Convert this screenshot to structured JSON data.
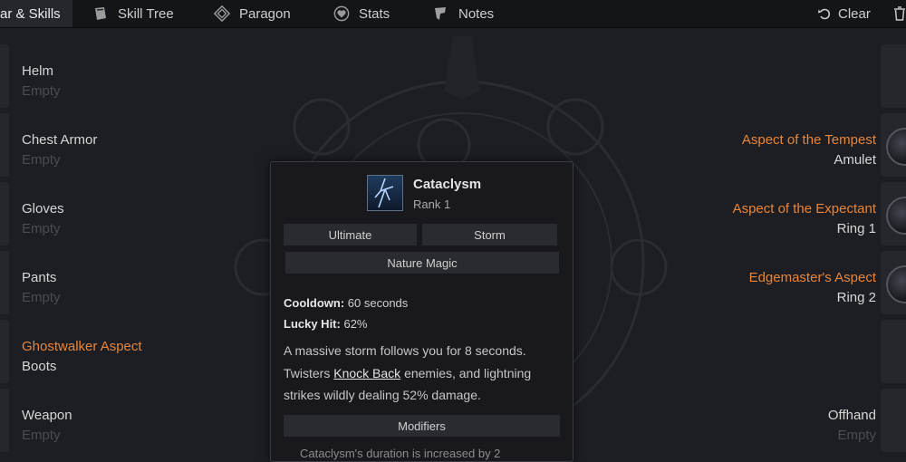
{
  "tabs": [
    {
      "label": "ar & Skills",
      "icon": "gear-skills-icon",
      "active": true
    },
    {
      "label": "Skill Tree",
      "icon": "book-icon"
    },
    {
      "label": "Paragon",
      "icon": "paragon-diamond-icon"
    },
    {
      "label": "Stats",
      "icon": "shield-heart-icon"
    },
    {
      "label": "Notes",
      "icon": "note-icon"
    }
  ],
  "toolbar": {
    "clear_label": "Clear",
    "clear_icon": "undo-icon",
    "delete_icon": "trash-icon"
  },
  "left_slots": [
    {
      "title": "Helm",
      "sub": "Empty"
    },
    {
      "title": "Chest Armor",
      "sub": "Empty"
    },
    {
      "title": "Gloves",
      "sub": "Empty"
    },
    {
      "title": "Pants",
      "sub": "Empty"
    },
    {
      "title": "Ghostwalker Aspect",
      "sub": "Boots"
    },
    {
      "title": "Weapon",
      "sub": "Empty"
    }
  ],
  "right_slots": [
    {
      "title": "Aspect of the Tempest",
      "sub": "Amulet"
    },
    {
      "title": "Aspect of the Expectant",
      "sub": "Ring 1"
    },
    {
      "title": "Edgemaster's Aspect",
      "sub": "Ring 2"
    },
    {
      "title": "Offhand",
      "sub": "Empty"
    }
  ],
  "tooltip": {
    "name": "Cataclysm",
    "rank": "Rank 1",
    "icon": "lightning-storm-icon",
    "tags": [
      "Ultimate",
      "Storm"
    ],
    "category": "Nature Magic",
    "cooldown_label": "Cooldown:",
    "cooldown_value": "60 seconds",
    "lucky_label": "Lucky Hit:",
    "lucky_value": "62%",
    "desc_1": "A massive storm follows you for 8 seconds. Twisters",
    "desc_link": "Knock Back",
    "desc_2": "enemies, and lightning strikes wildly dealing 52% damage.",
    "modifiers_label": "Modifiers",
    "modifier_text": "Cataclysm's duration is increased by 2"
  },
  "colors": {
    "accent_orange": "#e8853a",
    "background": "#1d1e23",
    "empty_text": "#4b4c52"
  }
}
